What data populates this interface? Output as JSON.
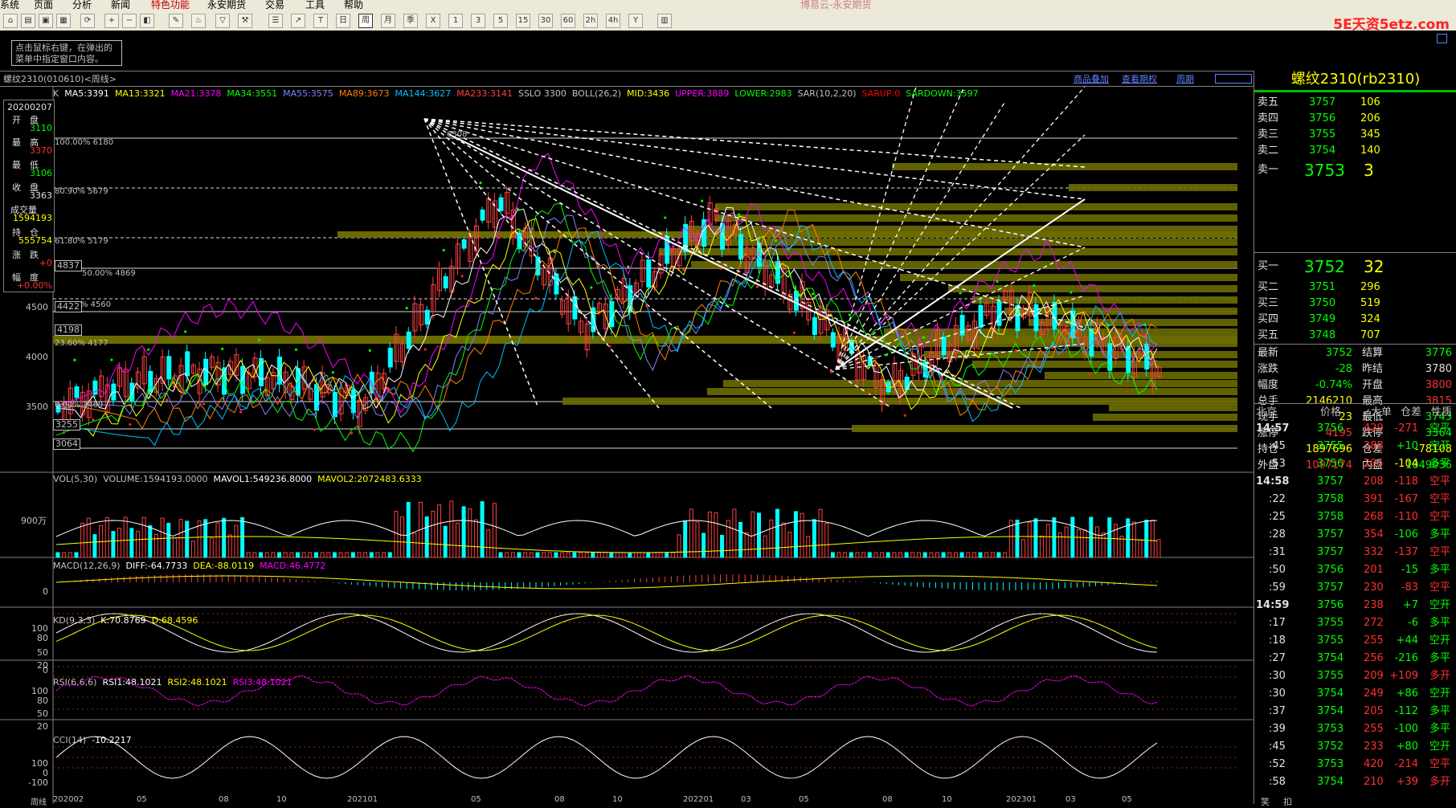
{
  "menu": {
    "items": [
      "系统",
      "页面",
      "分析",
      "新闻",
      "特色功能",
      "永安期货",
      "交易",
      "工具",
      "帮助"
    ],
    "brand_title": "博易云-永安期货",
    "logo_text": "5E天资5etz.com"
  },
  "toolbar": {
    "period_buttons": [
      "1",
      "3",
      "5",
      "15",
      "30",
      "60",
      "2h",
      "4h",
      "Y"
    ]
  },
  "tip_text": "点击鼠标右键，在弹出的菜单中指定窗口内容。",
  "chart_header": {
    "title": "螺纹2310(010610)<周线>",
    "links": [
      "商品叠加",
      "查看期权",
      "周期"
    ]
  },
  "main_indicators": [
    {
      "text": "K",
      "color": "#c0c0c0"
    },
    {
      "text": "MA5:3391",
      "color": "#ffffff"
    },
    {
      "text": "MA13:3321",
      "color": "#ffff00"
    },
    {
      "text": "MA21:3378",
      "color": "#ff00ff"
    },
    {
      "text": "MA34:3551",
      "color": "#00ff00"
    },
    {
      "text": "MA55:3575",
      "color": "#8080ff"
    },
    {
      "text": "MA89:3673",
      "color": "#ff8000"
    },
    {
      "text": "MA144:3627",
      "color": "#00c0ff"
    },
    {
      "text": "MA233:3141",
      "color": "#ff4040"
    },
    {
      "text": "SSLO 3300",
      "color": "#c0c0c0"
    },
    {
      "text": "BOLL(26,2)",
      "color": "#c0c0c0"
    },
    {
      "text": "MID:3436",
      "color": "#ffff00"
    },
    {
      "text": "UPPER:3889",
      "color": "#ff00ff"
    },
    {
      "text": "LOWER:2983",
      "color": "#00ff00"
    },
    {
      "text": "SAR(10,2,20)",
      "color": "#c0c0c0"
    },
    {
      "text": "SARUP:0",
      "color": "#ff0000"
    },
    {
      "text": "SARDOWN:3597",
      "color": "#00ff00"
    }
  ],
  "left_panel": [
    {
      "label": "20200207",
      "value": ""
    },
    {
      "label": "开　盘",
      "value": "3110"
    },
    {
      "label": "最　高",
      "value": "3370"
    },
    {
      "label": "最　低",
      "value": "3106"
    },
    {
      "label": "收　盘",
      "value": "3363"
    },
    {
      "label": "成交量",
      "value": "1594193"
    },
    {
      "label": "持　仓",
      "value": "555754"
    },
    {
      "label": "涨　跌",
      "value": "+0"
    },
    {
      "label": "幅　度",
      "value": "+0.00%"
    }
  ],
  "price_axis": {
    "labels": [
      "4500",
      "4000",
      "3500"
    ],
    "box_labels": [
      "4837",
      "4422",
      "4198",
      "3255",
      "3064"
    ],
    "fib_labels": [
      "100.00% 6180",
      "80.90% 5679",
      "61.80% 5179",
      "50.00% 4869",
      "% 4560",
      "23.60% 4177",
      "0.00% 3469"
    ],
    "peak_label": "6308"
  },
  "volume": {
    "indicators": [
      {
        "text": "VOL(5,30)",
        "color": "#c0c0c0"
      },
      {
        "text": "VOLUME:1594193.0000",
        "color": "#c0c0c0"
      },
      {
        "text": "MAVOL1:549236.8000",
        "color": "#ffffff"
      },
      {
        "text": "MAVOL2:2072483.6333",
        "color": "#ffff00"
      }
    ],
    "axis_label": "900万"
  },
  "macd": {
    "indicators": [
      {
        "text": "MACD(12,26,9)",
        "color": "#c0c0c0"
      },
      {
        "text": "DIFF:-64.7733",
        "color": "#ffffff"
      },
      {
        "text": "DEA:-88.0119",
        "color": "#ffff00"
      },
      {
        "text": "MACD:46.4772",
        "color": "#ff00ff"
      }
    ],
    "axis_label": "0"
  },
  "kd": {
    "indicators": [
      {
        "text": "KD(9,3,3)",
        "color": "#c0c0c0"
      },
      {
        "text": "K:70.8769",
        "color": "#ffffff"
      },
      {
        "text": "D:68.4596",
        "color": "#ffff00"
      }
    ],
    "axis_labels": [
      "100",
      "80",
      "50",
      "20",
      "0"
    ]
  },
  "rsi": {
    "indicators": [
      {
        "text": "RSI(6,6,6)",
        "color": "#c0c0c0"
      },
      {
        "text": "RSI1:48.1021",
        "color": "#ffffff"
      },
      {
        "text": "RSI2:48.1021",
        "color": "#ffff00"
      },
      {
        "text": "RSI3:48.1021",
        "color": "#ff00ff"
      }
    ],
    "axis_labels": [
      "100",
      "80",
      "50",
      "20"
    ]
  },
  "cci": {
    "indicators": [
      {
        "text": "CCI(14)",
        "color": "#c0c0c0"
      },
      {
        "text": "-10.2217",
        "color": "#ffffff"
      }
    ],
    "axis_labels": [
      "100",
      "0",
      "-100"
    ]
  },
  "time_axis": {
    "label": "周线",
    "ticks": [
      "202002",
      "05",
      "08",
      "10",
      "202101",
      "05",
      "08",
      "10",
      "202201",
      "03",
      "05",
      "08",
      "10",
      "202301",
      "03",
      "05"
    ]
  },
  "quote": {
    "title": "螺纹2310(rb2310)",
    "asks": [
      {
        "label": "卖五",
        "price": "3757",
        "vol": "106"
      },
      {
        "label": "卖四",
        "price": "3756",
        "vol": "206"
      },
      {
        "label": "卖三",
        "price": "3755",
        "vol": "345"
      },
      {
        "label": "卖二",
        "price": "3754",
        "vol": "140"
      },
      {
        "label": "卖一",
        "price": "3753",
        "vol": "3"
      }
    ],
    "bids": [
      {
        "label": "买一",
        "price": "3752",
        "vol": "32"
      },
      {
        "label": "买二",
        "price": "3751",
        "vol": "296"
      },
      {
        "label": "买三",
        "price": "3750",
        "vol": "519"
      },
      {
        "label": "买四",
        "price": "3749",
        "vol": "324"
      },
      {
        "label": "买五",
        "price": "3748",
        "vol": "707"
      }
    ],
    "stats": [
      {
        "l1": "最新",
        "v1": "3752",
        "c1": "c-g",
        "l2": "结算",
        "v2": "3776",
        "c2": "c-g"
      },
      {
        "l1": "涨跌",
        "v1": "-28",
        "c1": "c-g",
        "l2": "昨结",
        "v2": "3780",
        "c2": "c-w"
      },
      {
        "l1": "幅度",
        "v1": "-0.74%",
        "c1": "c-g",
        "l2": "开盘",
        "v2": "3800",
        "c2": "c-r"
      },
      {
        "l1": "总手",
        "v1": "2146210",
        "c1": "c-y",
        "l2": "最高",
        "v2": "3815",
        "c2": "c-r"
      },
      {
        "l1": "现手",
        "v1": "23",
        "c1": "c-y",
        "l2": "最低",
        "v2": "3743",
        "c2": "c-g"
      },
      {
        "l1": "涨停",
        "v1": "4195",
        "c1": "c-r",
        "l2": "跌停",
        "v2": "3364",
        "c2": "c-g"
      },
      {
        "l1": "持仓",
        "v1": "1897696",
        "c1": "c-y",
        "l2": "仓差",
        "v2": "-78108",
        "c2": "c-y"
      },
      {
        "l1": "外盘",
        "v1": "1097174",
        "c1": "c-r",
        "l2": "内盘",
        "v2": "1049036",
        "c2": "c-g"
      }
    ],
    "tick_header": [
      "北京",
      "价格",
      "↙大单",
      "仓差",
      "性质"
    ],
    "ticks": [
      {
        "time": "14:57",
        "price": "3756",
        "vol": "429",
        "diff": "-271",
        "nature": "空平",
        "dc": "c-r",
        "nc": "c-g"
      },
      {
        "time": ":45",
        "price": "3755",
        "vol": "288",
        "diff": "+10",
        "nature": "空开",
        "dc": "c-g",
        "nc": "c-g"
      },
      {
        "time": ":53",
        "price": "3756",
        "vol": "205",
        "diff": "-104",
        "nature": "多平",
        "dc": "c-y",
        "nc": "c-g"
      },
      {
        "time": "14:58",
        "price": "3757",
        "vol": "208",
        "diff": "-118",
        "nature": "空平",
        "dc": "c-r",
        "nc": "c-r"
      },
      {
        "time": ":22",
        "price": "3758",
        "vol": "391",
        "diff": "-167",
        "nature": "空平",
        "dc": "c-r",
        "nc": "c-r"
      },
      {
        "time": ":25",
        "price": "3758",
        "vol": "268",
        "diff": "-110",
        "nature": "空平",
        "dc": "c-r",
        "nc": "c-r"
      },
      {
        "time": ":28",
        "price": "3757",
        "vol": "354",
        "diff": "-106",
        "nature": "多平",
        "dc": "c-g",
        "nc": "c-g"
      },
      {
        "time": ":31",
        "price": "3757",
        "vol": "332",
        "diff": "-137",
        "nature": "空平",
        "dc": "c-r",
        "nc": "c-r"
      },
      {
        "time": ":50",
        "price": "3756",
        "vol": "201",
        "diff": "-15",
        "nature": "多平",
        "dc": "c-g",
        "nc": "c-g"
      },
      {
        "time": ":59",
        "price": "3757",
        "vol": "230",
        "diff": "-83",
        "nature": "空平",
        "dc": "c-r",
        "nc": "c-r"
      },
      {
        "time": "14:59",
        "price": "3756",
        "vol": "238",
        "diff": "+7",
        "nature": "空开",
        "dc": "c-g",
        "nc": "c-g"
      },
      {
        "time": ":17",
        "price": "3755",
        "vol": "272",
        "diff": "-6",
        "nature": "多平",
        "dc": "c-g",
        "nc": "c-g"
      },
      {
        "time": ":18",
        "price": "3755",
        "vol": "255",
        "diff": "+44",
        "nature": "空开",
        "dc": "c-g",
        "nc": "c-g"
      },
      {
        "time": ":27",
        "price": "3754",
        "vol": "256",
        "diff": "-216",
        "nature": "多平",
        "dc": "c-g",
        "nc": "c-g"
      },
      {
        "time": ":30",
        "price": "3755",
        "vol": "209",
        "diff": "+109",
        "nature": "多开",
        "dc": "c-r",
        "nc": "c-r"
      },
      {
        "time": ":30",
        "price": "3754",
        "vol": "249",
        "diff": "+86",
        "nature": "空开",
        "dc": "c-g",
        "nc": "c-g"
      },
      {
        "time": ":37",
        "price": "3754",
        "vol": "205",
        "diff": "-112",
        "nature": "多平",
        "dc": "c-g",
        "nc": "c-g"
      },
      {
        "time": ":39",
        "price": "3753",
        "vol": "255",
        "diff": "-100",
        "nature": "多平",
        "dc": "c-g",
        "nc": "c-g"
      },
      {
        "time": ":45",
        "price": "3752",
        "vol": "233",
        "diff": "+80",
        "nature": "空开",
        "dc": "c-g",
        "nc": "c-g"
      },
      {
        "time": ":52",
        "price": "3753",
        "vol": "420",
        "diff": "-214",
        "nature": "空平",
        "dc": "c-r",
        "nc": "c-r"
      },
      {
        "time": ":58",
        "price": "3754",
        "vol": "210",
        "diff": "+39",
        "nature": "多开",
        "dc": "c-r",
        "nc": "c-r"
      }
    ],
    "bottom_tabs": [
      "笑",
      "扣"
    ]
  }
}
